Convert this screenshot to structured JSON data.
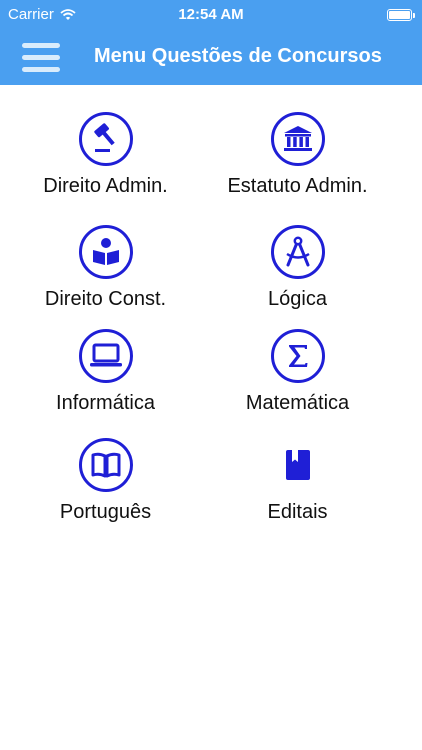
{
  "status_bar": {
    "carrier": "Carrier",
    "time": "12:54 AM",
    "wifi_icon": "wifi-icon",
    "battery_icon": "battery-icon",
    "battery_level": 1.0
  },
  "nav": {
    "title": "Menu Questões de Concursos",
    "menu_icon": "hamburger-menu-icon"
  },
  "colors": {
    "nav_background": "#4a9ff0",
    "icon_accent": "#1f1fd6",
    "label_text": "#111111"
  },
  "menu": {
    "items": [
      {
        "label": "Direito Admin.",
        "icon": "gavel-icon"
      },
      {
        "label": "Estatuto Admin.",
        "icon": "courthouse-icon"
      },
      {
        "label": "Direito Const.",
        "icon": "reader-book-icon"
      },
      {
        "label": "Lógica",
        "icon": "compass-icon"
      },
      {
        "label": "Informática",
        "icon": "laptop-icon"
      },
      {
        "label": "Matemática",
        "icon": "sigma-icon"
      },
      {
        "label": "Português",
        "icon": "open-book-icon"
      },
      {
        "label": "Editais",
        "icon": "bookmark-book-icon"
      }
    ]
  }
}
